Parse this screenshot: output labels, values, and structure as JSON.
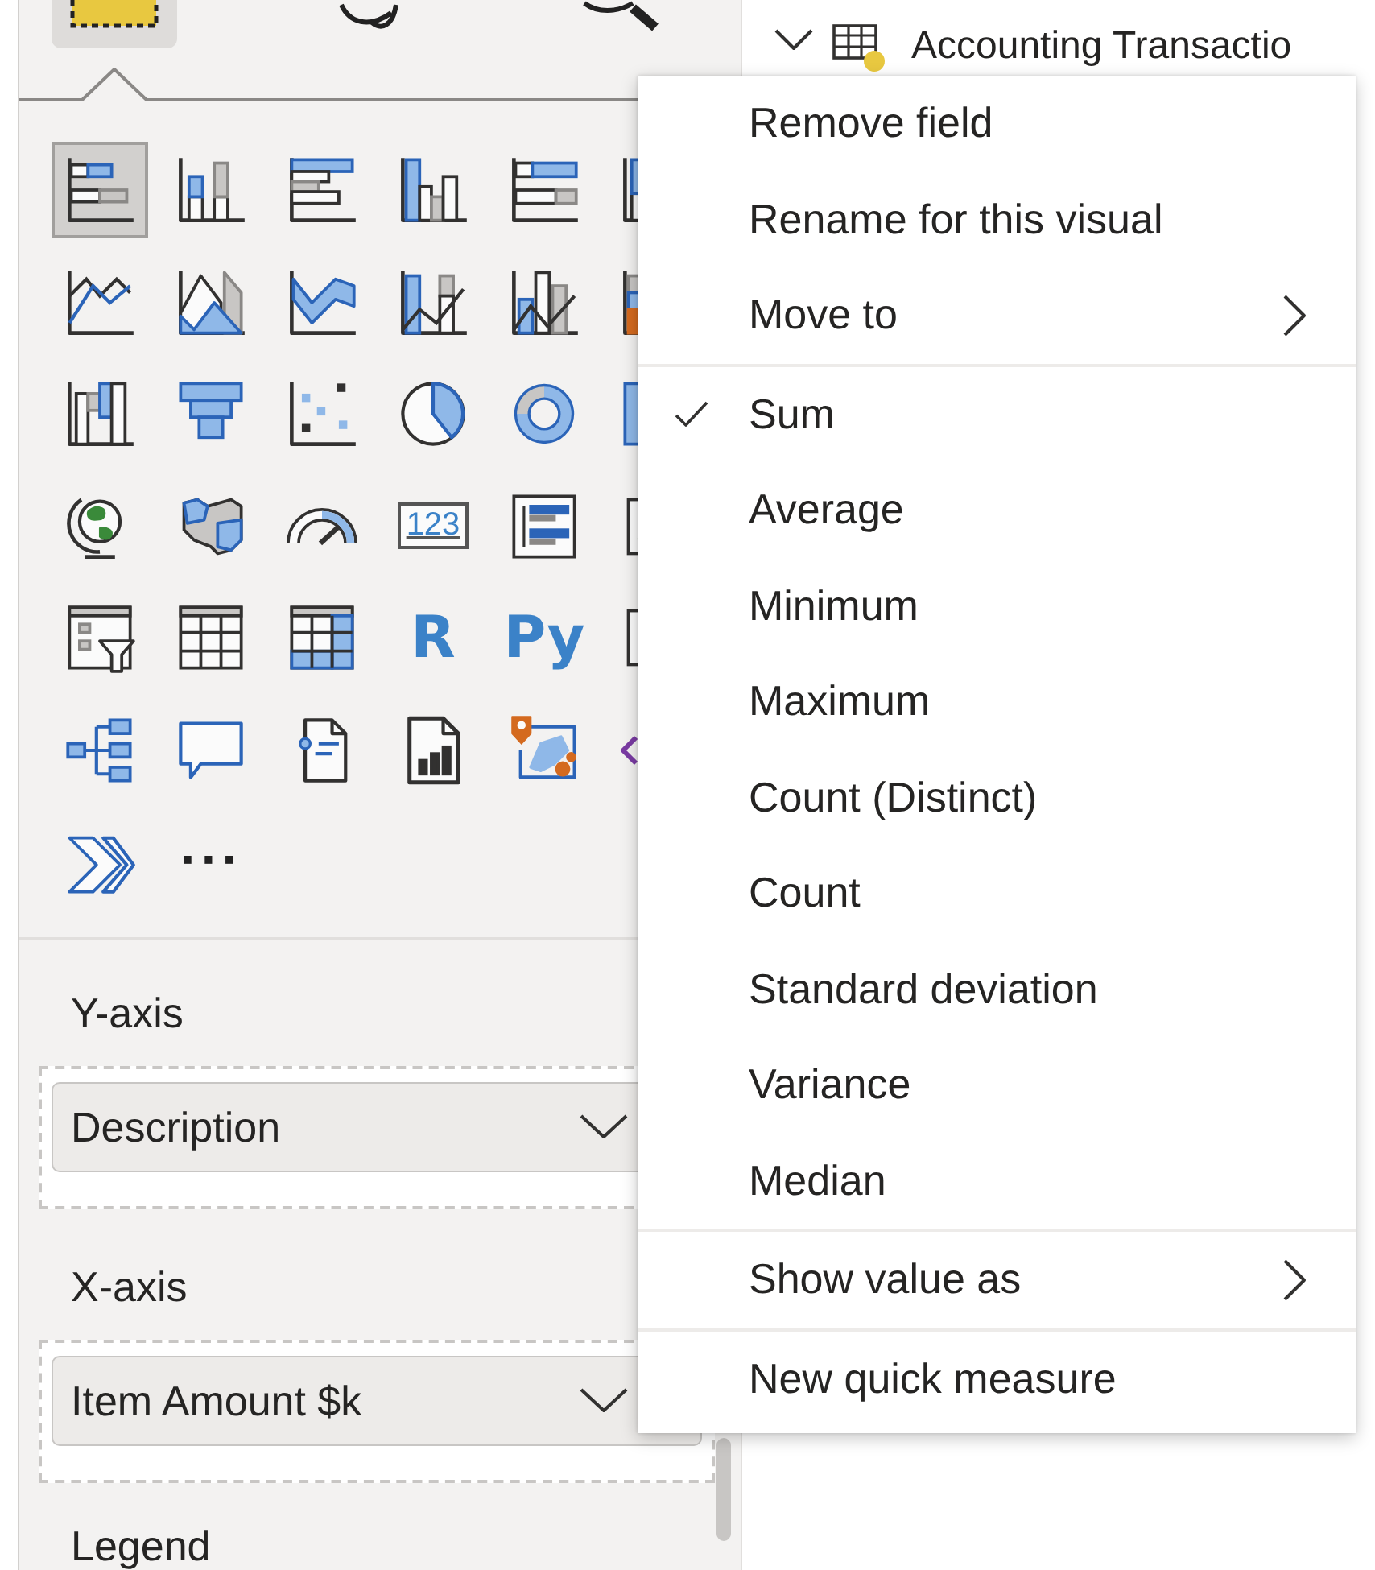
{
  "tabs": [
    {
      "kind": "build",
      "selected": true
    },
    {
      "kind": "format",
      "selected": false
    },
    {
      "kind": "analytics",
      "selected": false
    }
  ],
  "visuals": [
    {
      "kind": "stackedbar",
      "selected": true
    },
    {
      "kind": "stackedcolumn",
      "selected": false
    },
    {
      "kind": "clusteredbar",
      "selected": false
    },
    {
      "kind": "clusteredcolumn",
      "selected": false
    },
    {
      "kind": "fullbar",
      "selected": false
    },
    {
      "kind": "fullcolumn",
      "selected": false
    },
    {
      "kind": "line",
      "selected": false
    },
    {
      "kind": "area",
      "selected": false
    },
    {
      "kind": "stackedarea",
      "selected": false
    },
    {
      "kind": "linecolumn",
      "selected": false
    },
    {
      "kind": "lineclustered",
      "selected": false
    },
    {
      "kind": "ribbon",
      "selected": false
    },
    {
      "kind": "waterfall",
      "selected": false
    },
    {
      "kind": "funnel",
      "selected": false
    },
    {
      "kind": "scatter",
      "selected": false
    },
    {
      "kind": "pie",
      "selected": false
    },
    {
      "kind": "donut",
      "selected": false
    },
    {
      "kind": "treemap",
      "selected": false
    },
    {
      "kind": "globe",
      "selected": false
    },
    {
      "kind": "filledmap",
      "selected": false
    },
    {
      "kind": "gauge",
      "selected": false
    },
    {
      "kind": "card",
      "label": "123",
      "selected": false
    },
    {
      "kind": "multicard",
      "selected": false
    },
    {
      "kind": "kpi",
      "selected": false
    },
    {
      "kind": "slicer",
      "selected": false
    },
    {
      "kind": "table",
      "selected": false
    },
    {
      "kind": "matrix",
      "selected": false
    },
    {
      "kind": "text",
      "label": "R",
      "selected": false
    },
    {
      "kind": "text",
      "label": "Py",
      "selected": false
    },
    {
      "kind": "influencers",
      "selected": false
    },
    {
      "kind": "decomposition",
      "selected": false
    },
    {
      "kind": "qa",
      "selected": false
    },
    {
      "kind": "narrative",
      "selected": false
    },
    {
      "kind": "paginated",
      "selected": false
    },
    {
      "kind": "azuremap",
      "selected": false
    },
    {
      "kind": "powerapps",
      "selected": false
    },
    {
      "kind": "automate",
      "selected": false
    },
    {
      "kind": "more",
      "label": "···",
      "selected": false
    }
  ],
  "wells": [
    {
      "label": "Y-axis",
      "field": "Description"
    },
    {
      "label": "X-axis",
      "field": "Item Amount $k"
    },
    {
      "label": "Legend"
    }
  ],
  "fields_pane": {
    "table": {
      "label": "Accounting Transactio",
      "expanded": true
    }
  },
  "context_menu": {
    "groups": [
      [
        {
          "label": "Remove field",
          "kind": "action"
        },
        {
          "label": "Rename for this visual",
          "kind": "action"
        },
        {
          "label": "Move to",
          "kind": "submenu"
        }
      ],
      [
        {
          "label": "Sum",
          "kind": "aggregate",
          "checked": true
        },
        {
          "label": "Average",
          "kind": "aggregate",
          "checked": false
        },
        {
          "label": "Minimum",
          "kind": "aggregate",
          "checked": false
        },
        {
          "label": "Maximum",
          "kind": "aggregate",
          "checked": false
        },
        {
          "label": "Count (Distinct)",
          "kind": "aggregate",
          "checked": false
        },
        {
          "label": "Count",
          "kind": "aggregate",
          "checked": false
        },
        {
          "label": "Standard deviation",
          "kind": "aggregate",
          "checked": false
        },
        {
          "label": "Variance",
          "kind": "aggregate",
          "checked": false
        },
        {
          "label": "Median",
          "kind": "aggregate",
          "checked": false
        }
      ],
      [
        {
          "label": "Show value as",
          "kind": "submenu"
        }
      ],
      [
        {
          "label": "New quick measure",
          "kind": "action"
        }
      ]
    ]
  }
}
